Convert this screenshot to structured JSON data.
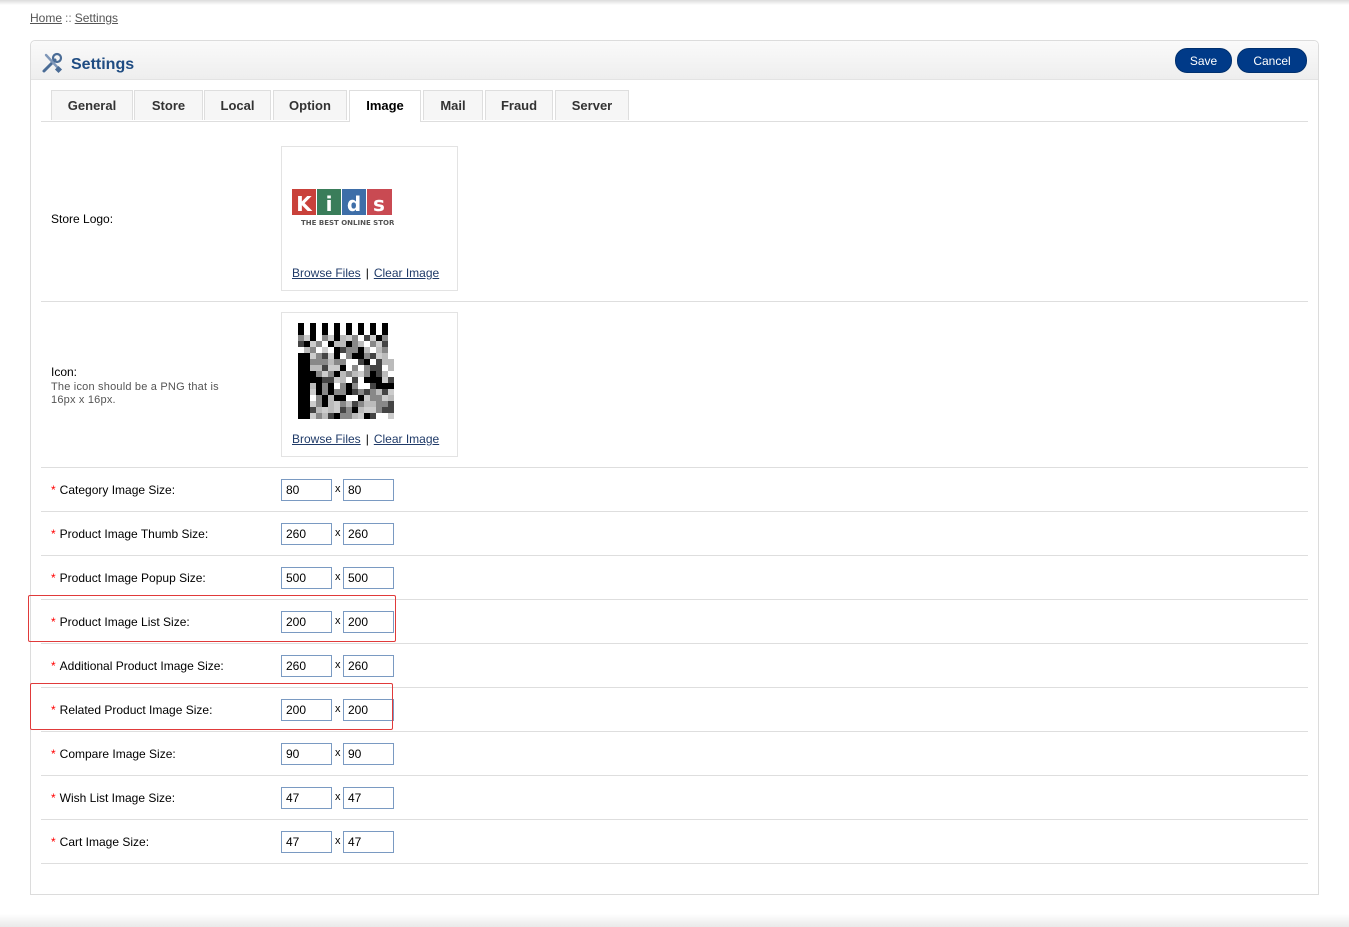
{
  "breadcrumb": {
    "home": "Home",
    "separator": "::",
    "current": "Settings"
  },
  "header": {
    "title": "Settings",
    "icon": "wrench-screwdriver-icon",
    "save_label": "Save",
    "cancel_label": "Cancel"
  },
  "tabs": [
    "General",
    "Store",
    "Local",
    "Option",
    "Image",
    "Mail",
    "Fraud",
    "Server"
  ],
  "active_tab": "Image",
  "store_logo": {
    "label": "Store Logo:",
    "logo_letters": [
      "K",
      "i",
      "d",
      "s"
    ],
    "logo_tagline": "THE BEST ONLINE STORE",
    "browse": "Browse Files",
    "clear": "Clear Image",
    "bar": "|"
  },
  "icon_field": {
    "label": "Icon:",
    "help": "The icon should be a PNG that is 16px x 16px.",
    "browse": "Browse Files",
    "clear": "Clear Image",
    "bar": "|"
  },
  "required_mark": "*",
  "x_separator": "x",
  "size_fields": [
    {
      "label": "Category Image Size:",
      "width": "80",
      "height": "80"
    },
    {
      "label": "Product Image Thumb Size:",
      "width": "260",
      "height": "260"
    },
    {
      "label": "Product Image Popup Size:",
      "width": "500",
      "height": "500"
    },
    {
      "label": "Product Image List Size:",
      "width": "200",
      "height": "200"
    },
    {
      "label": "Additional Product Image Size:",
      "width": "260",
      "height": "260"
    },
    {
      "label": "Related Product Image Size:",
      "width": "200",
      "height": "200"
    },
    {
      "label": "Compare Image Size:",
      "width": "90",
      "height": "90"
    },
    {
      "label": "Wish List Image Size:",
      "width": "47",
      "height": "47"
    },
    {
      "label": "Cart Image Size:",
      "width": "47",
      "height": "47"
    }
  ],
  "colors": {
    "accent": "#003a88",
    "title": "#1f4c82",
    "required": "#ff0000",
    "highlight": "#e03a3a"
  }
}
